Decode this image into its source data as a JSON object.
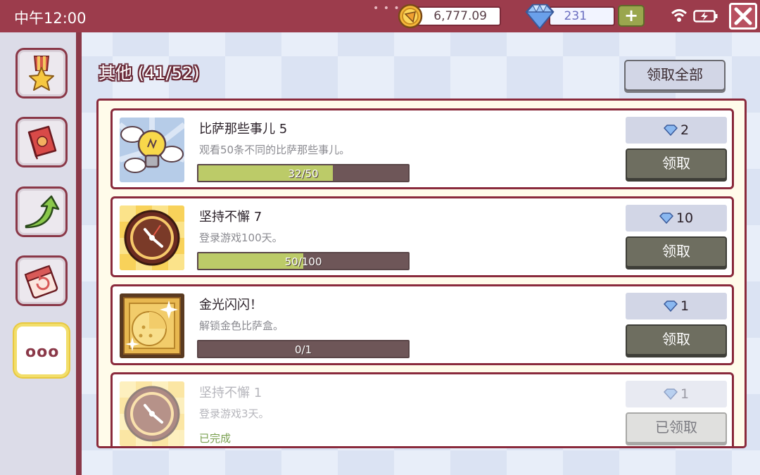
{
  "status_bar": {
    "time": "中午12:00"
  },
  "currency": {
    "coins": "6,777.09",
    "gems": "231",
    "add_label": "+"
  },
  "colors": {
    "header": "#9c3c4c",
    "accent": "#8a2a3c",
    "progress_fill": "#bccb68",
    "button_dark": "#6e6e60"
  },
  "sidebar": {
    "items": [
      {
        "name": "medal-icon",
        "active": false
      },
      {
        "name": "book-icon",
        "active": false
      },
      {
        "name": "up-arrow-icon",
        "active": false
      },
      {
        "name": "calendar-icon",
        "active": false
      },
      {
        "name": "more-icon",
        "label": "ooo",
        "active": true
      }
    ]
  },
  "section": {
    "title": "其他 (41/52)",
    "claim_all_label": "领取全部"
  },
  "achievements": [
    {
      "name": "比萨那些事儿 5",
      "desc": "观看50条不同的比萨那些事儿。",
      "progress_text": "32/50",
      "progress": 0.64,
      "reward": "2",
      "button": "领取",
      "icon": "lightbulb-icon"
    },
    {
      "name": "坚持不懈 7",
      "desc": "登录游戏100天。",
      "progress_text": "50/100",
      "progress": 0.5,
      "reward": "10",
      "button": "领取",
      "icon": "clock-icon"
    },
    {
      "name": "金光闪闪！",
      "desc": "解锁金色比萨盒。",
      "progress_text": "0/1",
      "progress": 0,
      "reward": "1",
      "button": "领取",
      "icon": "golden-pizza-box-icon"
    },
    {
      "name": "坚持不懈 1",
      "desc": "登录游戏3天。",
      "status": "已完成",
      "reward": "1",
      "button": "已领取",
      "icon": "clock-icon"
    }
  ]
}
